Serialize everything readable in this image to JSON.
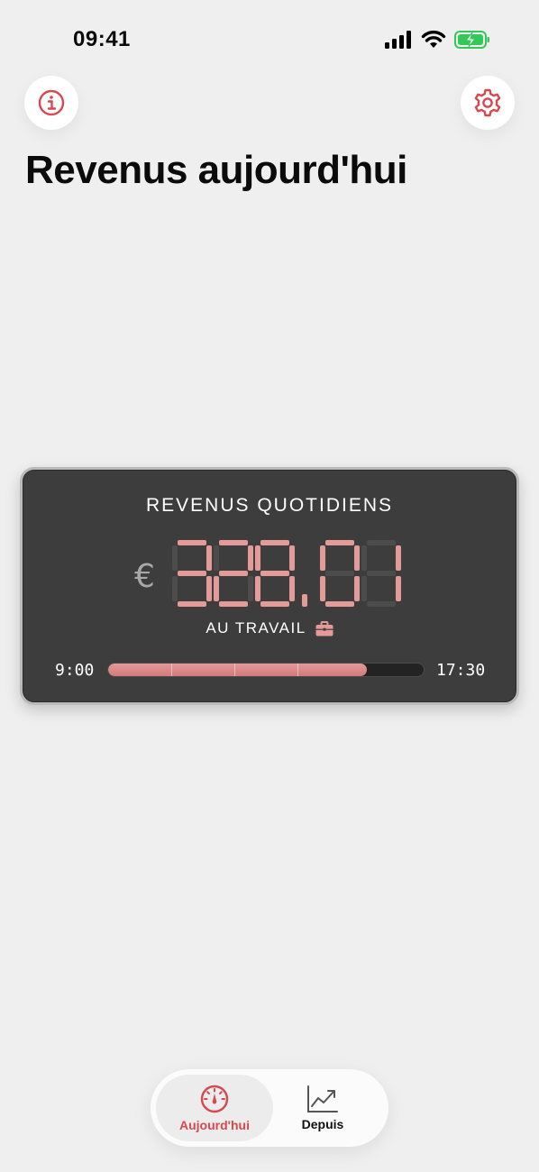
{
  "status_bar": {
    "time": "09:41",
    "icons": [
      "cellular-signal-icon",
      "wifi-icon",
      "battery-charging-icon"
    ]
  },
  "header": {
    "info_icon": "info-icon",
    "settings_icon": "gear-icon",
    "title": "Revenus aujourd'hui"
  },
  "card": {
    "title": "REVENUS QUOTIDIENS",
    "currency": "€",
    "amount": "328,01",
    "status": "AU TRAVAIL",
    "status_icon": "briefcase-icon",
    "start_time": "9:00",
    "end_time": "17:30",
    "progress": 0.82
  },
  "tabs": [
    {
      "label": "Aujourd'hui",
      "icon": "gauge-icon",
      "active": true
    },
    {
      "label": "Depuis",
      "icon": "chart-trend-icon",
      "active": false
    }
  ],
  "colors": {
    "accent": "#d9474f",
    "digit": "#e39a98",
    "card_bg": "#3d3d3d",
    "page_bg": "#efefef",
    "battery": "#34c759"
  }
}
